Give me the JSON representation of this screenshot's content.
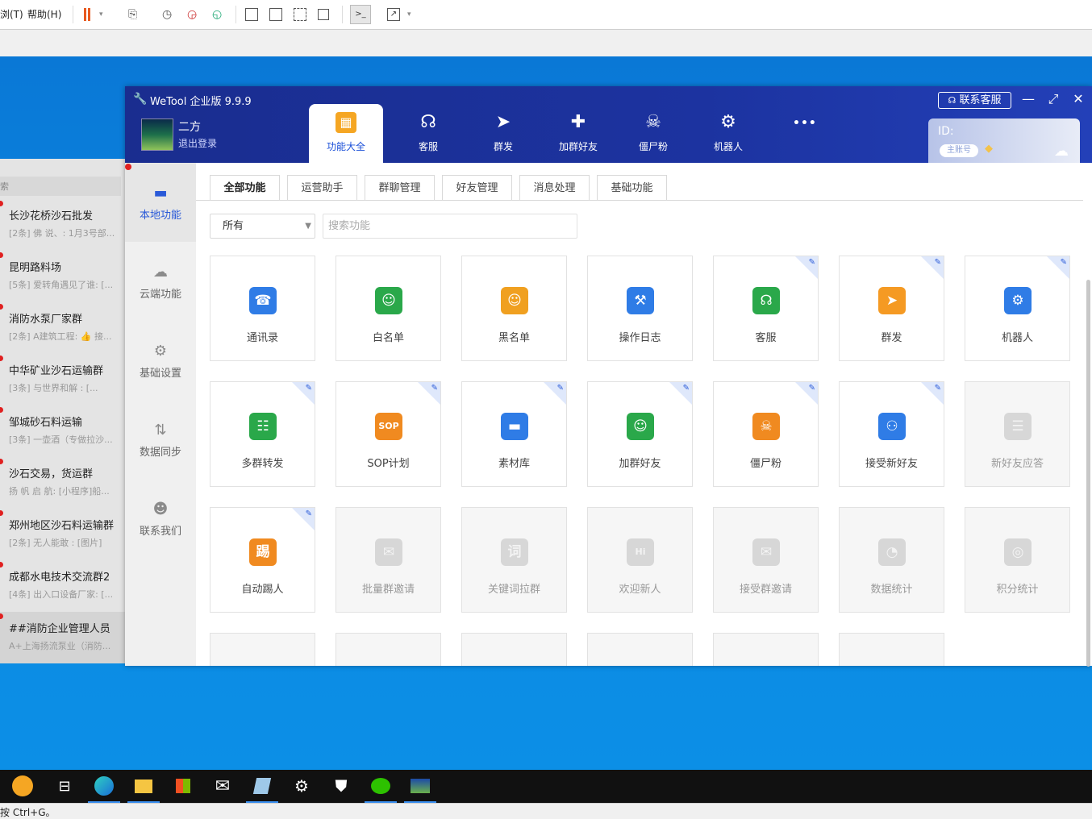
{
  "host": {
    "menu_partial": "浏(T)",
    "menu_help": "帮助(H)",
    "status_hint": "按 Ctrl+G。"
  },
  "chatlist": {
    "header_partial": "索",
    "items": [
      {
        "title": "长沙花桥沙石批发",
        "snippet": "[2条] 佛 说、: 1月3号部..."
      },
      {
        "title": "昆明路料场",
        "snippet": "[5条] 爱转角遇见了谁: [..."
      },
      {
        "title": "消防水泵厂家群",
        "snippet": "[2条] A建筑工程: 👍 接..."
      },
      {
        "title": "中华矿业沙石运输群",
        "snippet": "[3条] 与世界和解 : [..."
      },
      {
        "title": "邹城砂石料运输",
        "snippet": "[3条] 一壶酒（专做拉沙..."
      },
      {
        "title": "沙石交易，货运群",
        "snippet": "扬 帆 启 航: [小程序]船..."
      },
      {
        "title": "郑州地区沙石料运输群",
        "snippet": "[2条] 无人能敢 : [图片]"
      },
      {
        "title": "成都水电技术交流群2",
        "snippet": "[4条] 出入口设备厂家: [..."
      },
      {
        "title": "##消防企业管理人员",
        "snippet": "A+上海扬流泵业（消防..."
      }
    ]
  },
  "app": {
    "title": "WeTool 企业版 9.9.9",
    "user_name": "二方",
    "logout": "退出登录",
    "contact_service": "联系客服",
    "id_label": "ID:",
    "main_account": "主账号",
    "more": "•••",
    "nav_tabs": [
      {
        "label": "功能大全",
        "icon": "grid-icon"
      },
      {
        "label": "客服",
        "icon": "headset-icon"
      },
      {
        "label": "群发",
        "icon": "paper-plane-icon"
      },
      {
        "label": "加群好友",
        "icon": "add-user-icon"
      },
      {
        "label": "僵尸粉",
        "icon": "skull-icon"
      },
      {
        "label": "机器人",
        "icon": "robot-icon"
      }
    ],
    "side_nav": [
      {
        "label": "本地功能",
        "icon": "monitor-icon"
      },
      {
        "label": "云端功能",
        "icon": "cloud-icon"
      },
      {
        "label": "基础设置",
        "icon": "gear-icon"
      },
      {
        "label": "数据同步",
        "icon": "sync-icon"
      },
      {
        "label": "联系我们",
        "icon": "person-icon"
      }
    ],
    "content_tabs": [
      "全部功能",
      "运营助手",
      "群聊管理",
      "好友管理",
      "消息处理",
      "基础功能"
    ],
    "filter_value": "所有",
    "search_placeholder": "搜索功能",
    "features": [
      {
        "label": "通讯录",
        "icon": "phonebook-icon",
        "color": "#2f7ce6"
      },
      {
        "label": "白名单",
        "icon": "user-check-icon",
        "color": "#2aa84a"
      },
      {
        "label": "黑名单",
        "icon": "user-block-icon",
        "color": "#f0a020"
      },
      {
        "label": "操作日志",
        "icon": "wrench-book-icon",
        "color": "#2f7ce6"
      },
      {
        "label": "客服",
        "icon": "headset-icon",
        "color": "#2aa84a"
      },
      {
        "label": "群发",
        "icon": "paper-plane-icon",
        "color": "#f59a23"
      },
      {
        "label": "机器人",
        "icon": "robot-icon",
        "color": "#2f7ce6"
      },
      {
        "label": "多群转发",
        "icon": "network-icon",
        "color": "#2aa84a"
      },
      {
        "label": "SOP计划",
        "icon": "sop-calendar-icon",
        "color": "#f08a20"
      },
      {
        "label": "素材库",
        "icon": "folder-icon",
        "color": "#2f7ce6"
      },
      {
        "label": "加群好友",
        "icon": "add-user-icon",
        "color": "#2aa84a"
      },
      {
        "label": "僵尸粉",
        "icon": "skull-icon",
        "color": "#f08a20"
      },
      {
        "label": "接受新好友",
        "icon": "users-icon",
        "color": "#2f7ce6"
      },
      {
        "label": "新好友应答",
        "icon": "chat-icon",
        "color": "#d7d7d7"
      },
      {
        "label": "自动踢人",
        "icon": "kick-icon",
        "color": "#f08a20"
      },
      {
        "label": "批量群邀请",
        "icon": "mail-heart-icon",
        "color": "#d7d7d7"
      },
      {
        "label": "关键词拉群",
        "icon": "keyword-icon",
        "color": "#d7d7d7"
      },
      {
        "label": "欢迎新人",
        "icon": "hi-icon",
        "color": "#d7d7d7"
      },
      {
        "label": "接受群邀请",
        "icon": "mail-check-icon",
        "color": "#d7d7d7"
      },
      {
        "label": "数据统计",
        "icon": "pie-icon",
        "color": "#d7d7d7"
      },
      {
        "label": "积分统计",
        "icon": "coins-icon",
        "color": "#d7d7d7"
      }
    ],
    "icon_glyphs": {
      "phonebook": "☎",
      "user": "☺",
      "wrench": "⚒",
      "headset": "☊",
      "plane": "➤",
      "robot": "⚙",
      "network": "☷",
      "sop": "SOP",
      "folder": "▬",
      "skull": "☠",
      "users": "⚇",
      "chat": "☰",
      "kick": "踢",
      "mail": "✉",
      "keyword": "词",
      "hi": "Hi",
      "pie": "◔",
      "coins": "◎"
    }
  }
}
